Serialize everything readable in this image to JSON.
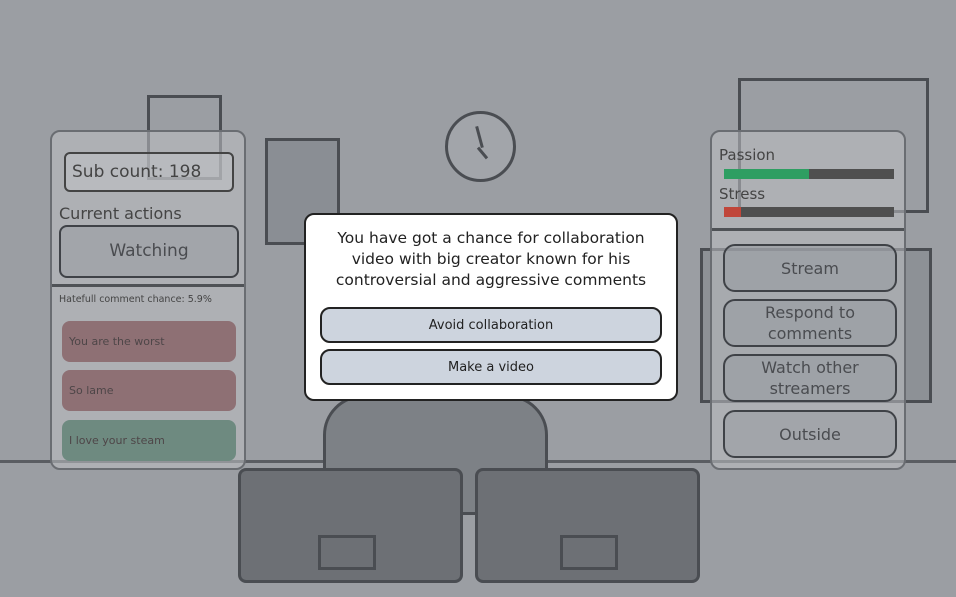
{
  "left_panel": {
    "sub_count": "Sub count: 198",
    "current_actions_label": "Current actions",
    "current_action": "Watching",
    "hateful_chance": "Hatefull comment chance: 5.9%",
    "comments": [
      {
        "text": "You are the worst",
        "type": "hateful",
        "color": "#8e7074"
      },
      {
        "text": "So lame",
        "type": "hateful",
        "color": "#8e7074"
      },
      {
        "text": "I love your steam",
        "type": "positive",
        "color": "#6e8a80"
      }
    ]
  },
  "right_panel": {
    "passion": {
      "label": "Passion",
      "value": 0.5,
      "color": "#2e9e62"
    },
    "stress": {
      "label": "Stress",
      "value": 0.1,
      "color": "#c0463a"
    },
    "actions": [
      {
        "label": "Stream"
      },
      {
        "label": "Respond to comments"
      },
      {
        "label": "Watch other streamers"
      },
      {
        "label": "Outside"
      }
    ]
  },
  "modal": {
    "message": "You have got a chance for collaboration video with big creator known for his controversial and aggressive comments",
    "options": [
      {
        "label": "Avoid collaboration"
      },
      {
        "label": "Make a video"
      }
    ]
  }
}
